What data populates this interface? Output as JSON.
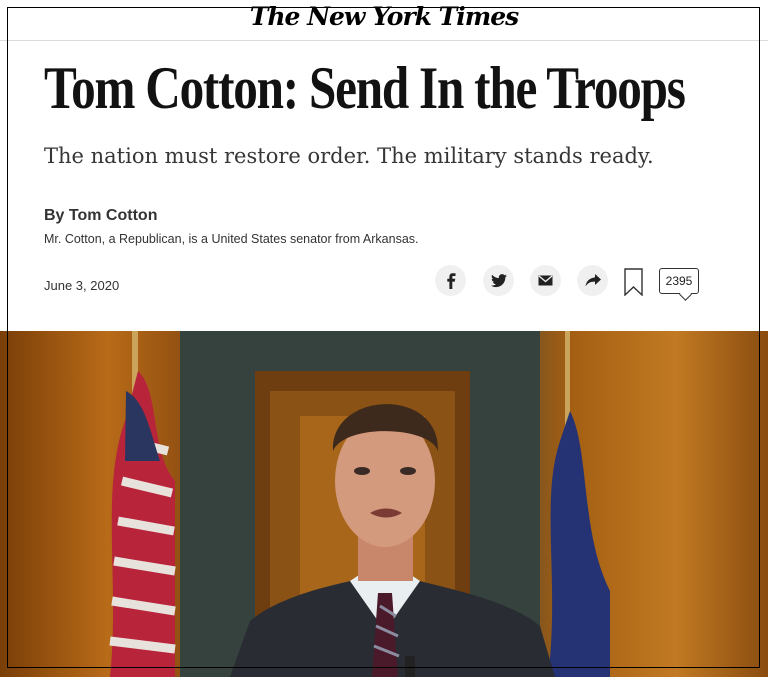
{
  "masthead": {
    "logo_text": "The New York Times"
  },
  "article": {
    "headline": "Tom Cotton: Send In the Troops",
    "summary": "The nation must restore order. The military stands ready.",
    "byline": "By Tom Cotton",
    "author_bio": "Mr. Cotton, a Republican, is a United States senator from Arkansas.",
    "date": "June 3, 2020"
  },
  "share_tools": {
    "icons": [
      "facebook-icon",
      "twitter-icon",
      "email-icon",
      "share-icon",
      "bookmark-icon"
    ],
    "comment_count": "2395"
  },
  "colors": {
    "icon_background": "#f0f0f0",
    "text": "#121212"
  }
}
